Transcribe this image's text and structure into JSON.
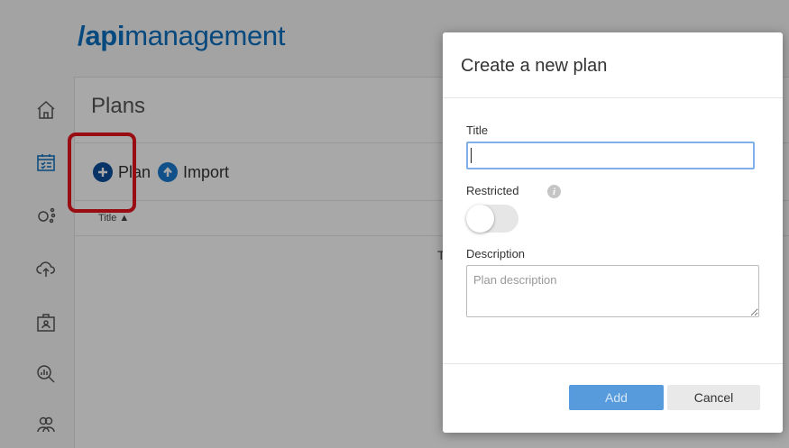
{
  "app": {
    "logo_slash": "/",
    "logo_api": "api",
    "logo_rest": "management"
  },
  "sidebar": {
    "items": [
      {
        "icon": "home-icon"
      },
      {
        "icon": "calendar-checklist-icon"
      },
      {
        "icon": "network-nodes-icon"
      },
      {
        "icon": "cloud-upload-icon"
      },
      {
        "icon": "id-badge-icon"
      },
      {
        "icon": "analytics-search-icon"
      },
      {
        "icon": "users-icon"
      }
    ]
  },
  "plans_page": {
    "title": "Plans",
    "add_plan_label": "Plan",
    "import_label": "Import",
    "column_title": "Title ▲",
    "empty_text": "T"
  },
  "modal": {
    "title": "Create a new plan",
    "title_label": "Title",
    "title_value": "",
    "restricted_label": "Restricted",
    "restricted_on": false,
    "description_label": "Description",
    "description_placeholder": "Plan description",
    "add_button": "Add",
    "cancel_button": "Cancel"
  },
  "colors": {
    "brand": "#0a6fc0",
    "primary_button": "#3a8ad8",
    "highlight": "#e8141c"
  }
}
